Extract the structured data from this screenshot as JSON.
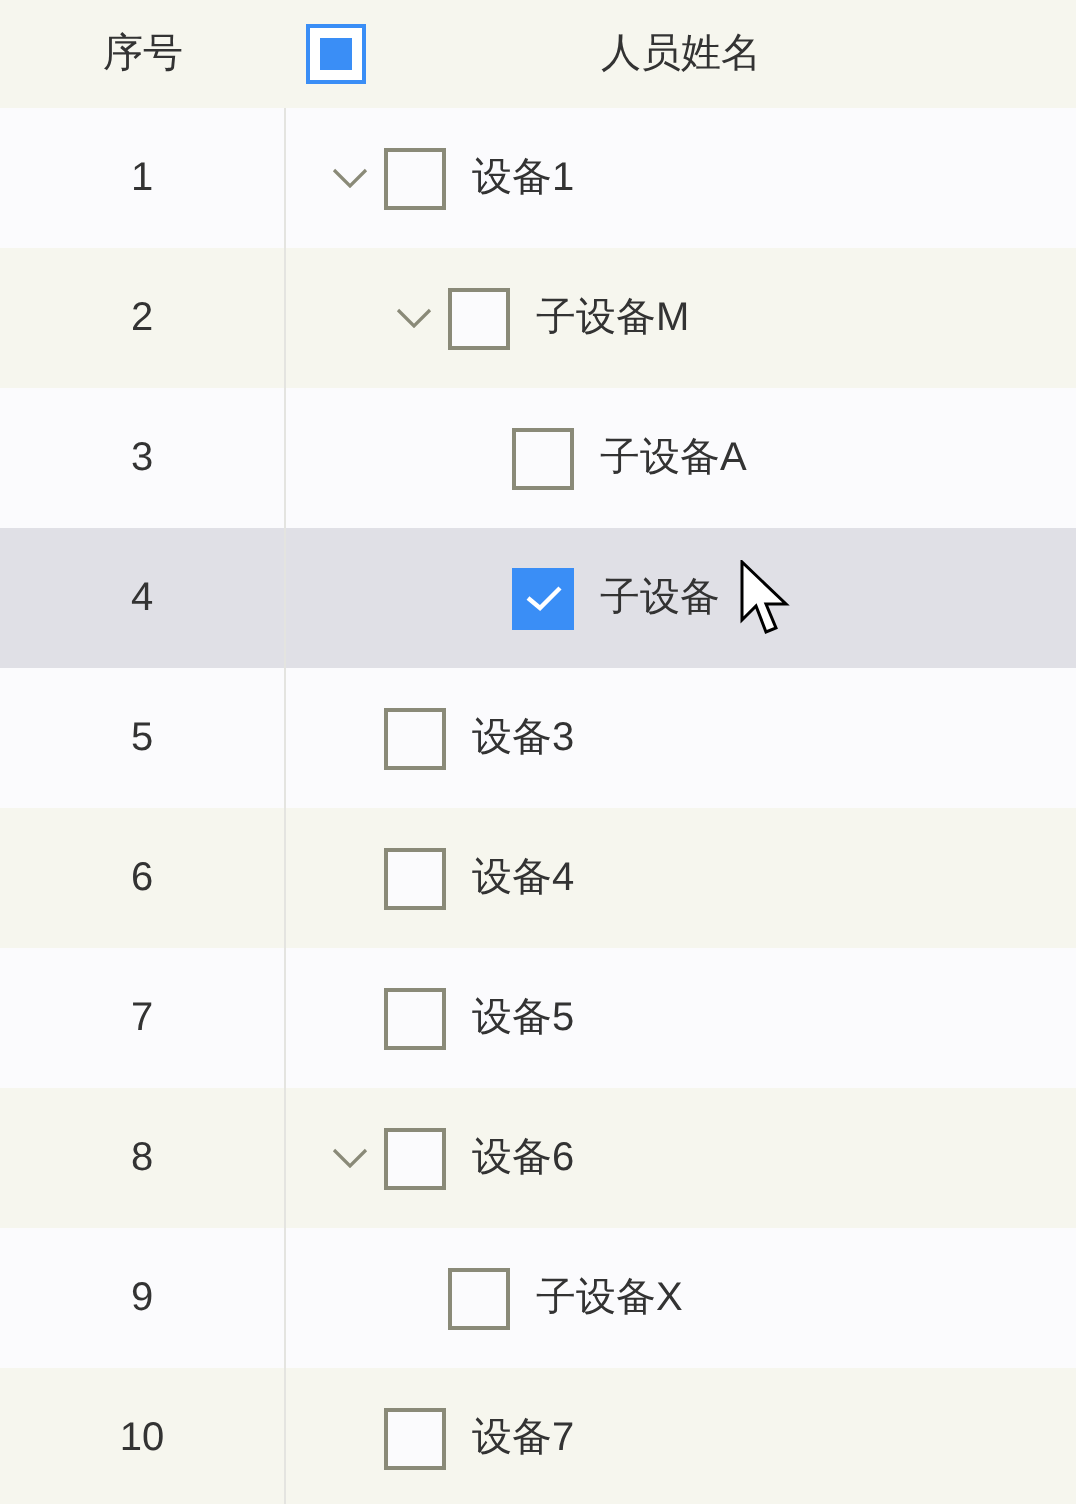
{
  "table": {
    "columns": [
      {
        "label": "序号"
      },
      {
        "label": "人员姓名"
      }
    ],
    "select_all": {
      "checked": false,
      "indeterminate": true
    },
    "rows": [
      {
        "index": "1",
        "name": "设备1",
        "checked": false,
        "hovered": false,
        "expanded": true,
        "children": [
          {
            "index": "2",
            "name": "子设备M",
            "checked": false,
            "hovered": false,
            "expanded": true,
            "children": [
              {
                "index": "3",
                "name": "子设备A",
                "checked": false,
                "hovered": false
              },
              {
                "index": "4",
                "name": "子设备",
                "checked": true,
                "hovered": true
              }
            ]
          }
        ]
      },
      {
        "index": "5",
        "name": "设备3",
        "checked": false,
        "hovered": false
      },
      {
        "index": "6",
        "name": "设备4",
        "checked": false,
        "hovered": false
      },
      {
        "index": "7",
        "name": "设备5",
        "checked": false,
        "hovered": false
      },
      {
        "index": "8",
        "name": "设备6",
        "checked": false,
        "hovered": false,
        "expanded": true,
        "children": [
          {
            "index": "9",
            "name": "子设备X",
            "checked": false,
            "hovered": false
          }
        ]
      },
      {
        "index": "10",
        "name": "设备7",
        "checked": false,
        "hovered": false
      }
    ]
  }
}
